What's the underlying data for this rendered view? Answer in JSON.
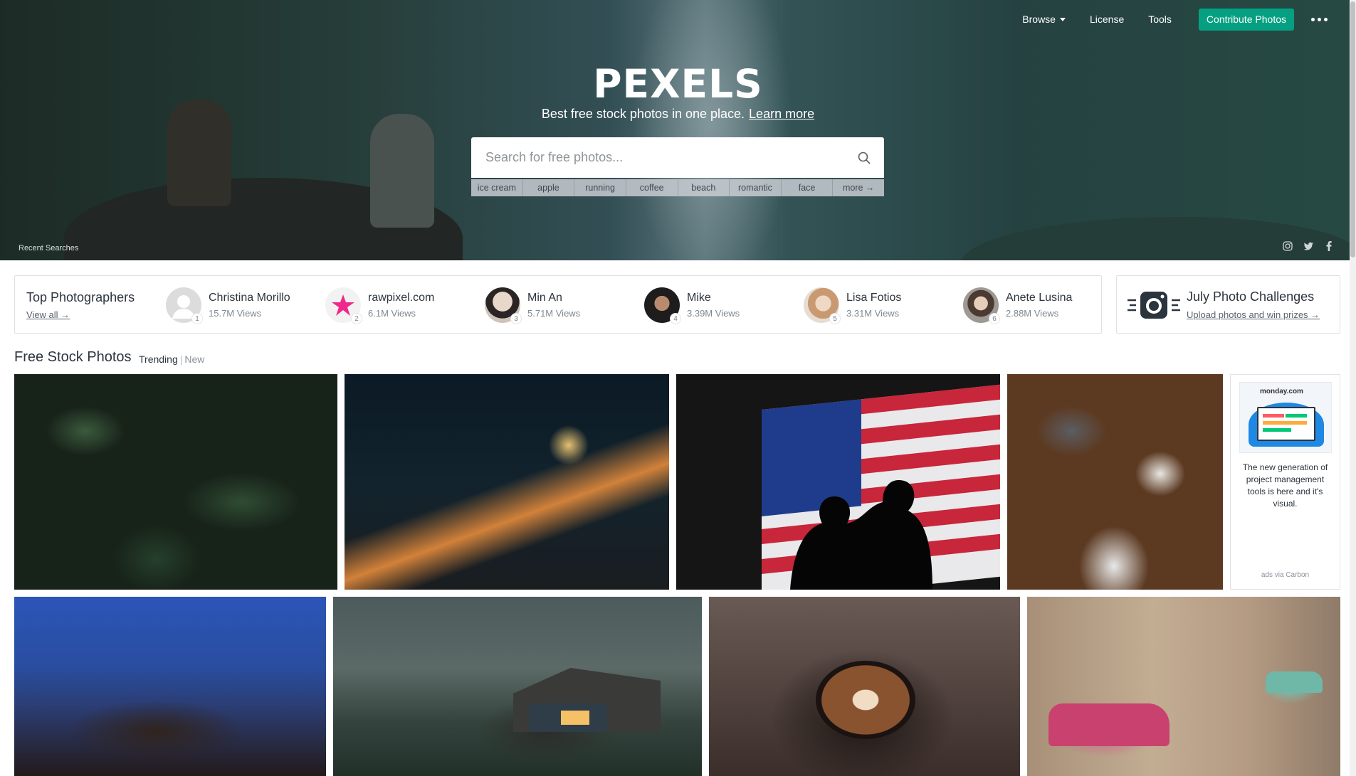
{
  "nav": {
    "browse": "Browse",
    "license": "License",
    "tools": "Tools",
    "contribute": "Contribute Photos"
  },
  "hero": {
    "logo": "PEXELS",
    "tagline": "Best free stock photos in one place.",
    "learn_more": "Learn more",
    "search_placeholder": "Search for free photos...",
    "tags": [
      "ice cream",
      "apple",
      "running",
      "coffee",
      "beach",
      "romantic",
      "face",
      "more →"
    ],
    "recent_searches": "Recent Searches",
    "social_icons": [
      "instagram-icon",
      "twitter-icon",
      "facebook-icon"
    ]
  },
  "top_photographers": {
    "title": "Top Photographers",
    "view_all": "View all →",
    "items": [
      {
        "rank": "1",
        "name": "Christina Morillo",
        "views": "15.7M Views",
        "color": "#dcdcdc"
      },
      {
        "rank": "2",
        "name": "rawpixel.com",
        "views": "6.1M Views",
        "color": "#f2f2f2"
      },
      {
        "rank": "3",
        "name": "Min An",
        "views": "5.71M Views",
        "color": "#d7c3b8"
      },
      {
        "rank": "4",
        "name": "Mike",
        "views": "3.39M Views",
        "color": "#2c2b2b"
      },
      {
        "rank": "5",
        "name": "Lisa Fotios",
        "views": "3.31M Views",
        "color": "#c9a184"
      },
      {
        "rank": "6",
        "name": "Anete Lusina",
        "views": "2.88M Views",
        "color": "#8c8b86"
      }
    ]
  },
  "challenges": {
    "title": "July Photo Challenges",
    "link": "Upload photos and win prizes →"
  },
  "section": {
    "title": "Free Stock Photos",
    "tab_active": "Trending",
    "tab_sep": "|",
    "tab_inactive": "New"
  },
  "ad": {
    "brand": "monday.com",
    "text": "The new generation of project management tools is here and it's visual.",
    "via": "ads via Carbon"
  },
  "colors": {
    "accent": "#05a081",
    "text": "#2c343e",
    "muted": "#7f8891",
    "rawpixel_star": "#f0288c"
  }
}
